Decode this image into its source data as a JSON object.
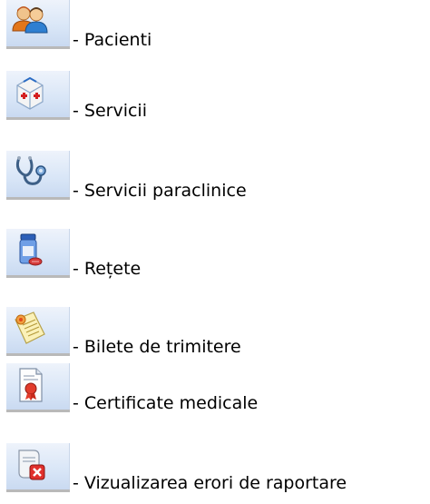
{
  "legend": {
    "items": [
      {
        "icon": "patients-icon",
        "label": "- Pacienti"
      },
      {
        "icon": "services-icon",
        "label": "- Servicii"
      },
      {
        "icon": "stethoscope-icon",
        "label": "- Servicii paraclinice"
      },
      {
        "icon": "prescription-bottle-icon",
        "label": "- Rețete"
      },
      {
        "icon": "referral-document-icon",
        "label": "- Bilete de trimitere"
      },
      {
        "icon": "medical-certificate-icon",
        "label": "- Certificate medicale"
      },
      {
        "icon": "error-report-icon",
        "label": "- Vizualizarea erori de raportare"
      }
    ]
  },
  "colors": {
    "button_gradient_top": "#eef3fb",
    "button_gradient_bottom": "#c7d8f0",
    "text": "#000000"
  }
}
